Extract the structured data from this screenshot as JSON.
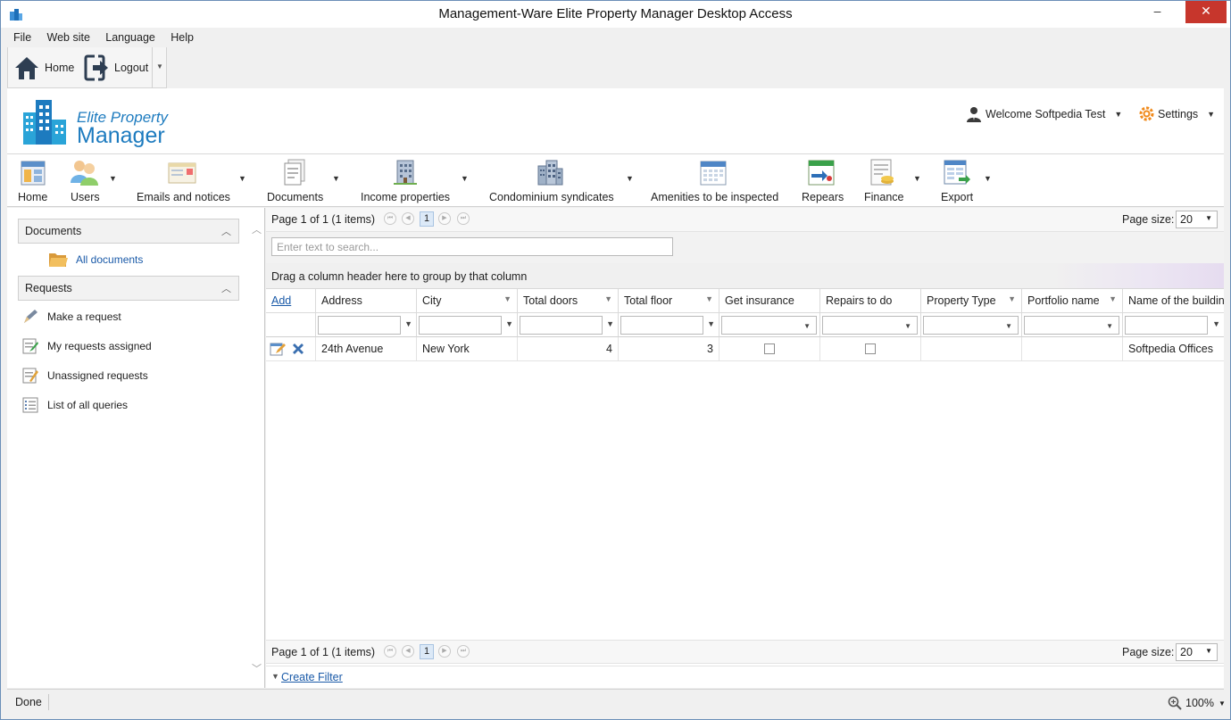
{
  "window": {
    "title": "Management-Ware Elite Property Manager Desktop Access",
    "minimize": "–",
    "maximize": "▫",
    "close": "✕"
  },
  "menu": [
    "File",
    "Web site",
    "Language",
    "Help"
  ],
  "quickbar": {
    "home": "Home",
    "logout": "Logout"
  },
  "logo": {
    "line1": "Elite Property",
    "line2": "Manager"
  },
  "header": {
    "welcome": "Welcome Softpedia Test",
    "settings": "Settings"
  },
  "ribbon": [
    {
      "label": "Home",
      "icon": "home-icon",
      "dropdown": false
    },
    {
      "label": "Users",
      "icon": "users-icon",
      "dropdown": true
    },
    {
      "label": "Emails and notices",
      "icon": "email-icon",
      "dropdown": true
    },
    {
      "label": "Documents",
      "icon": "documents-icon",
      "dropdown": true
    },
    {
      "label": "Income properties",
      "icon": "income-building-icon",
      "dropdown": true
    },
    {
      "label": "Condominium syndicates",
      "icon": "condo-building-icon",
      "dropdown": true
    },
    {
      "label": "Amenities to be inspected",
      "icon": "calendar-icon",
      "dropdown": false
    },
    {
      "label": "Repears",
      "icon": "repairs-icon",
      "dropdown": false
    },
    {
      "label": "Finance",
      "icon": "finance-icon",
      "dropdown": true
    },
    {
      "label": "Export",
      "icon": "export-icon",
      "dropdown": true
    }
  ],
  "left": {
    "documents_header": "Documents",
    "all_documents": "All documents",
    "requests_header": "Requests",
    "requests": [
      "Make a request",
      "My requests assigned",
      "Unassigned requests",
      "List of all queries"
    ]
  },
  "pager": {
    "info": "Page 1 of 1 (1 items)",
    "page": "1",
    "size_label": "Page size:",
    "size": "20"
  },
  "search": {
    "placeholder": "Enter text to search..."
  },
  "group_hint": "Drag a column header here to group by that column",
  "grid": {
    "add": "Add",
    "columns": [
      "Address",
      "City",
      "Total doors",
      "Total floor",
      "Get insurance",
      "Repairs to do",
      "Property Type",
      "Portfolio name",
      "Name of the building"
    ],
    "row": {
      "address": "24th Avenue",
      "city": "New York",
      "total_doors": "4",
      "total_floor": "3",
      "get_insurance": false,
      "repairs_to_do": false,
      "property_type": "",
      "portfolio_name": "",
      "building_name": "Softpedia Offices"
    }
  },
  "create_filter": "Create Filter",
  "status": {
    "text": "Done",
    "zoom": "100%"
  },
  "colors": {
    "accent": "#1d7bbf",
    "link": "#1a5aa8",
    "close": "#c7362c"
  }
}
